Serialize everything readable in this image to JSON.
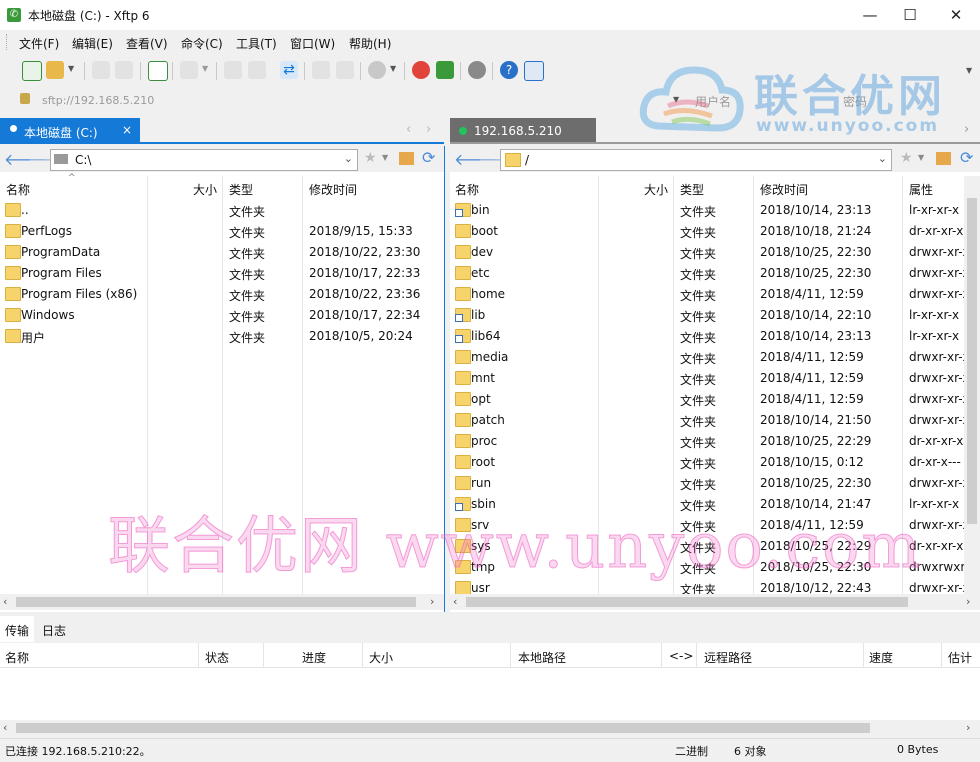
{
  "window": {
    "title": "本地磁盘 (C:) - Xftp 6",
    "minimize_glyph": "—",
    "maximize_glyph": "☐",
    "close_glyph": "✕"
  },
  "menu": [
    "文件(F)",
    "编辑(E)",
    "查看(V)",
    "命令(C)",
    "工具(T)",
    "窗口(W)",
    "帮助(H)"
  ],
  "address": {
    "text": "sftp://192.168.5.210",
    "user_placeholder": "用户名",
    "password_placeholder": "密码"
  },
  "watermark_logo": {
    "cn": "联合优网",
    "url": "www.unyoo.com"
  },
  "watermark_text": "联合优网 www.unyoo.com",
  "local": {
    "tab_label": "本地磁盘 (C:)",
    "tab_close": "×",
    "path": "C:\\",
    "columns": [
      "名称",
      "大小",
      "类型",
      "修改时间"
    ],
    "rows": [
      {
        "name": "..",
        "type": "文件夹",
        "mtime": ""
      },
      {
        "name": "PerfLogs",
        "type": "文件夹",
        "mtime": "2018/9/15, 15:33"
      },
      {
        "name": "ProgramData",
        "type": "文件夹",
        "mtime": "2018/10/22, 23:30"
      },
      {
        "name": "Program Files",
        "type": "文件夹",
        "mtime": "2018/10/17, 22:33"
      },
      {
        "name": "Program Files (x86)",
        "type": "文件夹",
        "mtime": "2018/10/22, 23:36"
      },
      {
        "name": "Windows",
        "type": "文件夹",
        "mtime": "2018/10/17, 22:34"
      },
      {
        "name": "用户",
        "type": "文件夹",
        "mtime": "2018/10/5, 20:24"
      }
    ]
  },
  "remote": {
    "tab_label": "192.168.5.210",
    "path": "/",
    "columns": [
      "名称",
      "大小",
      "类型",
      "修改时间",
      "属性"
    ],
    "rows": [
      {
        "name": "bin",
        "type": "文件夹",
        "mtime": "2018/10/14, 23:13",
        "attr": "lr-xr-xr-x",
        "link": true
      },
      {
        "name": "boot",
        "type": "文件夹",
        "mtime": "2018/10/18, 21:24",
        "attr": "dr-xr-xr-x",
        "link": false
      },
      {
        "name": "dev",
        "type": "文件夹",
        "mtime": "2018/10/25, 22:30",
        "attr": "drwxr-xr-x",
        "link": false
      },
      {
        "name": "etc",
        "type": "文件夹",
        "mtime": "2018/10/25, 22:30",
        "attr": "drwxr-xr-x",
        "link": false
      },
      {
        "name": "home",
        "type": "文件夹",
        "mtime": "2018/4/11, 12:59",
        "attr": "drwxr-xr-x",
        "link": false
      },
      {
        "name": "lib",
        "type": "文件夹",
        "mtime": "2018/10/14, 22:10",
        "attr": "lr-xr-xr-x",
        "link": true
      },
      {
        "name": "lib64",
        "type": "文件夹",
        "mtime": "2018/10/14, 23:13",
        "attr": "lr-xr-xr-x",
        "link": true
      },
      {
        "name": "media",
        "type": "文件夹",
        "mtime": "2018/4/11, 12:59",
        "attr": "drwxr-xr-x",
        "link": false
      },
      {
        "name": "mnt",
        "type": "文件夹",
        "mtime": "2018/4/11, 12:59",
        "attr": "drwxr-xr-x",
        "link": false
      },
      {
        "name": "opt",
        "type": "文件夹",
        "mtime": "2018/4/11, 12:59",
        "attr": "drwxr-xr-x",
        "link": false
      },
      {
        "name": "patch",
        "type": "文件夹",
        "mtime": "2018/10/14, 21:50",
        "attr": "drwxr-xr-x",
        "link": false
      },
      {
        "name": "proc",
        "type": "文件夹",
        "mtime": "2018/10/25, 22:29",
        "attr": "dr-xr-xr-x",
        "link": false
      },
      {
        "name": "root",
        "type": "文件夹",
        "mtime": "2018/10/15, 0:12",
        "attr": "dr-xr-x---",
        "link": false
      },
      {
        "name": "run",
        "type": "文件夹",
        "mtime": "2018/10/25, 22:30",
        "attr": "drwxr-xr-x",
        "link": false
      },
      {
        "name": "sbin",
        "type": "文件夹",
        "mtime": "2018/10/14, 21:47",
        "attr": "lr-xr-xr-x",
        "link": true
      },
      {
        "name": "srv",
        "type": "文件夹",
        "mtime": "2018/4/11, 12:59",
        "attr": "drwxr-xr-x",
        "link": false
      },
      {
        "name": "sys",
        "type": "文件夹",
        "mtime": "2018/10/25, 22:29",
        "attr": "dr-xr-xr-x",
        "link": false
      },
      {
        "name": "tmp",
        "type": "文件夹",
        "mtime": "2018/10/25, 22:30",
        "attr": "drwxrwxrwt",
        "link": false
      },
      {
        "name": "usr",
        "type": "文件夹",
        "mtime": "2018/10/12, 22:43",
        "attr": "drwxr-xr-x",
        "link": false
      }
    ]
  },
  "bottom_tabs": [
    "传输",
    "日志"
  ],
  "transfer_columns": [
    "名称",
    "状态",
    "进度",
    "大小",
    "本地路径",
    "<->",
    "远程路径",
    "速度",
    "估计剩"
  ],
  "status": {
    "connection": "已连接 192.168.5.210:22。",
    "mode": "二进制",
    "objects": "6 对象",
    "bytes": "0 Bytes"
  },
  "colors": {
    "local_tab_bg": "#1479d7",
    "remote_tab_bg": "#6d6d6d",
    "connected_dot": "#22c35a",
    "accent": "#1479d7"
  }
}
